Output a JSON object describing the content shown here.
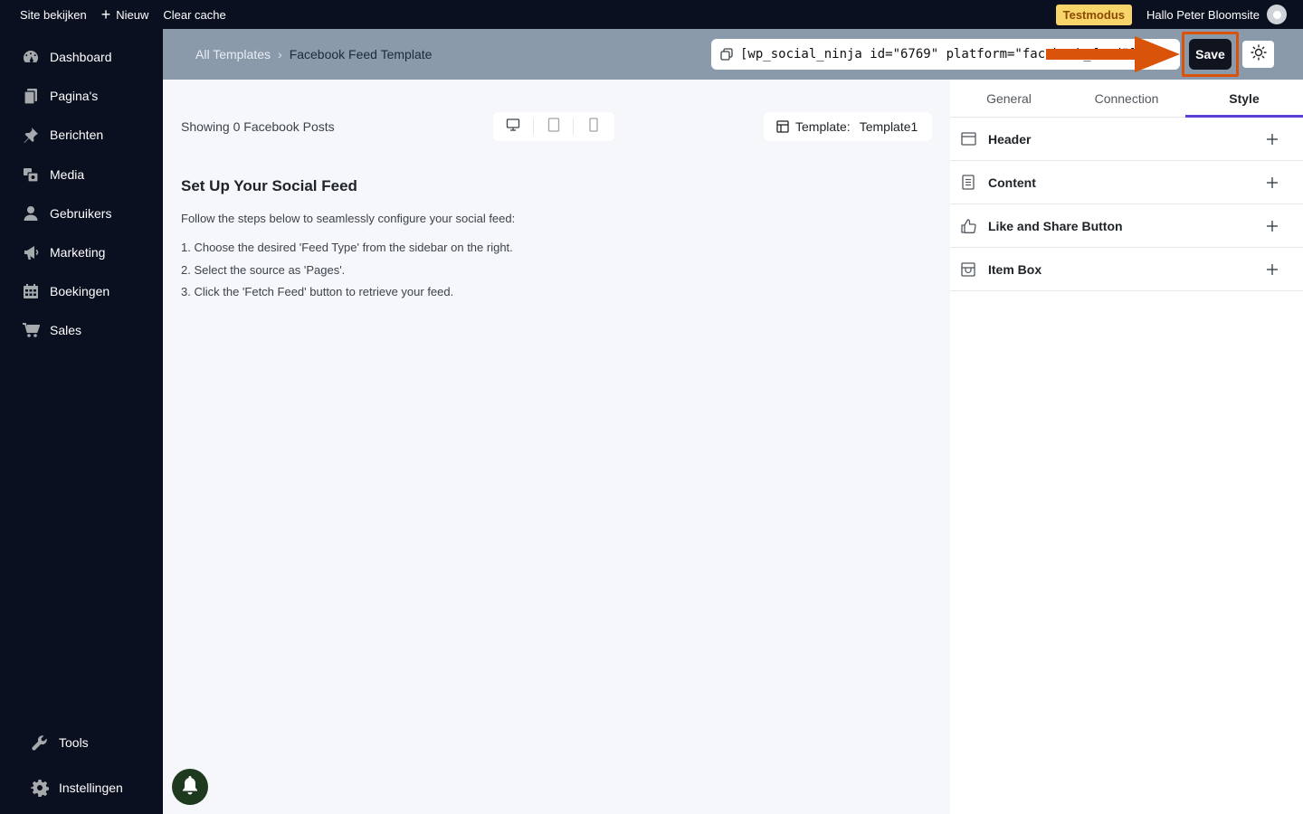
{
  "adminbar": {
    "view_site": "Site bekijken",
    "new_label": "Nieuw",
    "clear_cache": "Clear cache",
    "testmode_badge": "Testmodus",
    "greeting": "Hallo Peter Bloomsite"
  },
  "sidebar": {
    "items": [
      {
        "label": "Dashboard",
        "icon": "dashboard-icon"
      },
      {
        "label": "Pagina's",
        "icon": "pages-icon"
      },
      {
        "label": "Berichten",
        "icon": "pin-icon"
      },
      {
        "label": "Media",
        "icon": "media-icon"
      },
      {
        "label": "Gebruikers",
        "icon": "user-icon"
      },
      {
        "label": "Marketing",
        "icon": "megaphone-icon"
      },
      {
        "label": "Boekingen",
        "icon": "calendar-icon"
      },
      {
        "label": "Sales",
        "icon": "cart-icon"
      }
    ],
    "bottom_items": [
      {
        "label": "Tools",
        "icon": "wrench-icon"
      },
      {
        "label": "Instellingen",
        "icon": "gear-icon"
      }
    ]
  },
  "header": {
    "breadcrumb_root": "All Templates",
    "breadcrumb_current": "Facebook Feed Template",
    "shortcode": "[wp_social_ninja id=\"6769\" platform=\"facebook_feed\"]",
    "save_label": "Save"
  },
  "content": {
    "showing_text": "Showing 0 Facebook Posts",
    "template_label": "Template:",
    "template_value": "Template1",
    "setup_title": "Set Up Your Social Feed",
    "setup_intro": "Follow the steps below to seamlessly configure your social feed:",
    "steps": [
      "1. Choose the desired 'Feed Type' from the sidebar on the right.",
      "2. Select the source as 'Pages'.",
      "3. Click the 'Fetch Feed' button to retrieve your feed."
    ]
  },
  "panel": {
    "tabs": [
      {
        "label": "General",
        "active": false
      },
      {
        "label": "Connection",
        "active": false
      },
      {
        "label": "Style",
        "active": true
      }
    ],
    "sections": [
      {
        "label": "Header",
        "icon": "header-layout-icon"
      },
      {
        "label": "Content",
        "icon": "document-icon"
      },
      {
        "label": "Like and Share Button",
        "icon": "thumbs-up-icon"
      },
      {
        "label": "Item Box",
        "icon": "box-icon"
      }
    ]
  },
  "colors": {
    "admin_bg": "#0b1020",
    "topbar_bg": "#8a9aab",
    "accent_tab": "#5b3fd6",
    "highlight": "#d9540a",
    "testmode_bg": "#f8d56b"
  }
}
